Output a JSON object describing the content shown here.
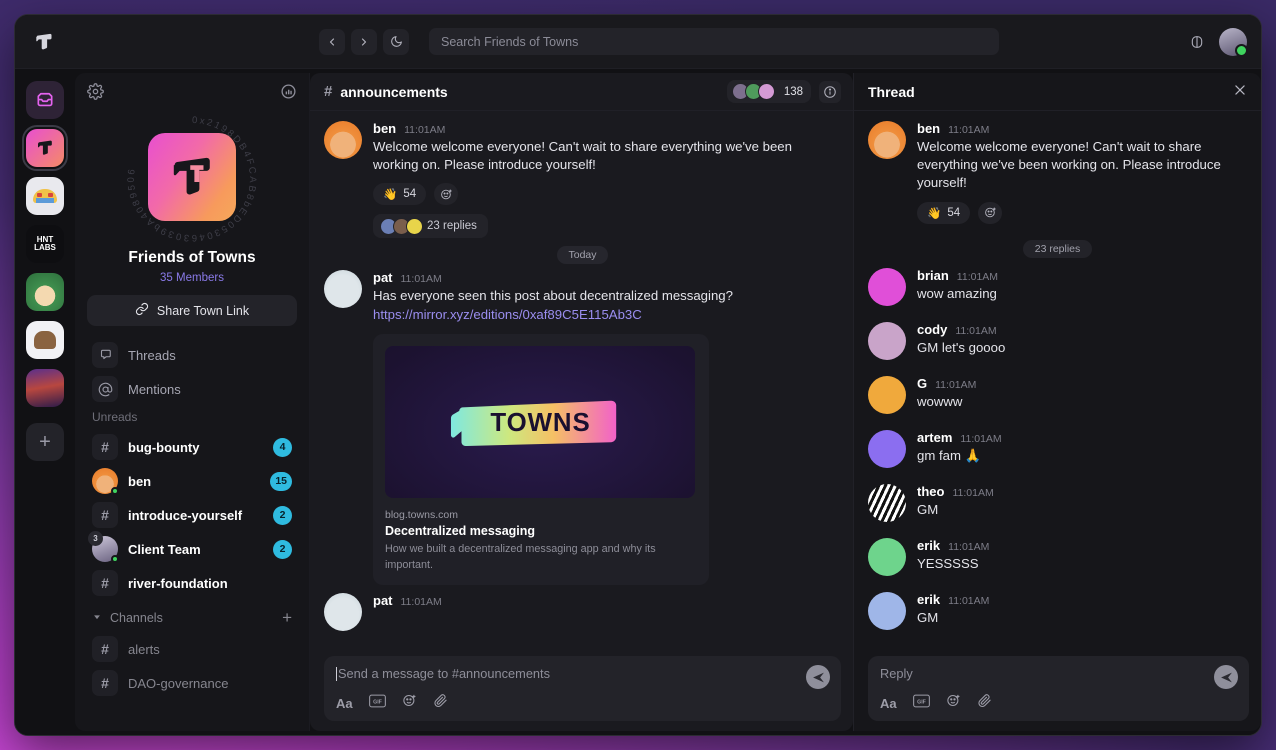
{
  "titlebar": {
    "logo": "towns-logo-icon",
    "back": "chevron-left-icon",
    "forward": "chevron-right-icon",
    "theme": "moon-icon",
    "search_placeholder": "Search Friends of Towns",
    "wallet_icon": "wallet-icon",
    "avatar": "user-avatar"
  },
  "rail": {
    "spaces": [
      {
        "name": "dms",
        "label": "",
        "unread": true,
        "selected": false,
        "style": "dm"
      },
      {
        "name": "friends-of-towns",
        "label": "",
        "unread": false,
        "selected": true,
        "style": "towns"
      },
      {
        "name": "taco-space",
        "label": "",
        "unread": true,
        "selected": false,
        "style": "taco"
      },
      {
        "name": "hnt-labs",
        "label": "HNT LABS",
        "unread": false,
        "selected": false,
        "style": "hnt"
      },
      {
        "name": "farmer-space",
        "label": "",
        "unread": true,
        "selected": false,
        "style": "farmer"
      },
      {
        "name": "bear-space",
        "label": "",
        "unread": false,
        "selected": false,
        "style": "bear"
      },
      {
        "name": "sunset-space",
        "label": "",
        "unread": false,
        "selected": false,
        "style": "sunset"
      }
    ],
    "add_label": "+"
  },
  "sidebar": {
    "settings_icon": "gear-icon",
    "stats_icon": "chart-icon",
    "address_ring": "0x2198DB4FCAB8bED0530463039bA4089506",
    "town_name": "Friends of Towns",
    "members": "35 Members",
    "share_label": "Share Town Link",
    "share_icon": "link-icon",
    "nav": [
      {
        "name": "threads",
        "label": "Threads",
        "icon": "threads-icon"
      },
      {
        "name": "mentions",
        "label": "Mentions",
        "icon": "at-icon"
      }
    ],
    "unreads_label": "Unreads",
    "unreads": [
      {
        "name": "bug-bounty",
        "label": "bug-bounty",
        "type": "channel",
        "badge": "4"
      },
      {
        "name": "ben",
        "label": "ben",
        "type": "dm",
        "badge": "15",
        "avatar": "a-ben",
        "online": true
      },
      {
        "name": "introduce-yourself",
        "label": "introduce-yourself",
        "type": "channel",
        "badge": "2"
      },
      {
        "name": "client-team",
        "label": "Client Team",
        "type": "group",
        "badge": "2",
        "group_count": "3",
        "online": true
      },
      {
        "name": "river-foundation",
        "label": "river-foundation",
        "type": "channel",
        "badge": ""
      }
    ],
    "channels_label": "Channels",
    "channels_add": "+",
    "channels": [
      {
        "name": "alerts",
        "label": "alerts"
      },
      {
        "name": "dao-governance",
        "label": "DAO-governance"
      }
    ]
  },
  "main": {
    "channel_hash": "#",
    "channel_name": "announcements",
    "member_count": "138",
    "info_icon": "info-icon",
    "divider_label": "Today",
    "messages": [
      {
        "name": "msg-ben-welcome",
        "author": "ben",
        "time": "11:01AM",
        "avatar": "a-ben",
        "text": "Welcome welcome everyone! Can't wait to share everything we've been working on. Please introduce yourself!",
        "reaction_emoji": "👋",
        "reaction_count": "54",
        "replies_label": "23 replies"
      },
      {
        "name": "msg-pat-link",
        "author": "pat",
        "time": "11:01AM",
        "avatar": "a-pat",
        "text": "Has everyone seen this post about decentralized messaging?",
        "link": "https://mirror.xyz/editions/0xaf89C5E115Ab3C",
        "preview": {
          "image_text": "TOWNS",
          "site": "blog.towns.com",
          "title": "Decentralized messaging",
          "description": "How we built a decentralized messaging app and why its important."
        }
      },
      {
        "name": "msg-pat-next",
        "author": "pat",
        "time": "11:01AM",
        "avatar": "a-pat",
        "text": ""
      }
    ],
    "composer": {
      "placeholder": "Send a message to #announcements",
      "tools": [
        "text-format-icon",
        "gif-icon",
        "emoji-icon",
        "attachment-icon"
      ],
      "send_icon": "send-icon"
    }
  },
  "thread": {
    "title": "Thread",
    "close_icon": "close-icon",
    "root": {
      "author": "ben",
      "time": "11:01AM",
      "avatar": "a-ben",
      "text": "Welcome welcome everyone! Can't wait to share everything we've been working on. Please introduce yourself!",
      "reaction_emoji": "👋",
      "reaction_count": "54"
    },
    "replies_sep": "23 replies",
    "replies": [
      {
        "name": "reply-brian",
        "author": "brian",
        "time": "11:01AM",
        "text": "wow amazing",
        "avatar": "a-brian"
      },
      {
        "name": "reply-cody",
        "author": "cody",
        "time": "11:01AM",
        "text": "GM let's goooo",
        "avatar": "a-cody"
      },
      {
        "name": "reply-g",
        "author": "G",
        "time": "11:01AM",
        "text": "wowww",
        "avatar": "a-g"
      },
      {
        "name": "reply-artem",
        "author": "artem",
        "time": "11:01AM",
        "text": "gm fam 🙏",
        "avatar": "a-artem"
      },
      {
        "name": "reply-theo",
        "author": "theo",
        "time": "11:01AM",
        "text": "GM",
        "avatar": "a-theo"
      },
      {
        "name": "reply-erik-1",
        "author": "erik",
        "time": "11:01AM",
        "text": "YESSSSS",
        "avatar": "a-erik1"
      },
      {
        "name": "reply-erik-2",
        "author": "erik",
        "time": "11:01AM",
        "text": "GM",
        "avatar": "a-erik2"
      }
    ],
    "composer": {
      "placeholder": "Reply",
      "send_icon": "send-icon"
    }
  },
  "colors": {
    "accent": "#8a7ae8",
    "badge": "#2fbbe0",
    "online": "#3fd45f",
    "link": "#9b8ef0"
  }
}
